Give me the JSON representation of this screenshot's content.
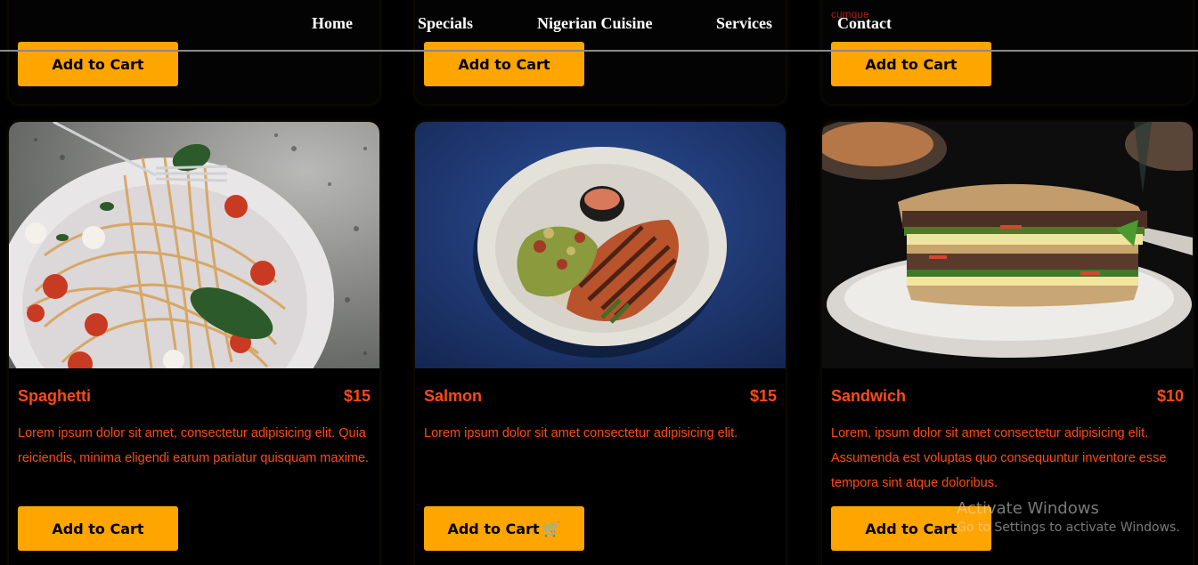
{
  "nav": {
    "links": [
      "Home",
      "Specials",
      "Nigerian Cuisine",
      "Services",
      "Contact"
    ],
    "stray_text": "cumque"
  },
  "top_row": {
    "buttons": [
      "Add to Cart",
      "Add to Cart",
      "Add to Cart"
    ]
  },
  "cards": [
    {
      "name": "Spaghetti",
      "price": "$15",
      "description": "Lorem ipsum dolor sit amet, consectetur adipisicing elit. Quia reiciendis, minima eligendi earum pariatur quisquam maxime.",
      "button": "Add to Cart",
      "image": "spaghetti-photo"
    },
    {
      "name": "Salmon",
      "price": "$15",
      "description": "Lorem ipsum dolor sit amet consectetur adipisicing elit.",
      "button": "Add to Cart",
      "button_icon": "🛒",
      "image": "salmon-photo"
    },
    {
      "name": "Sandwich",
      "price": "$10",
      "description": "Lorem, ipsum dolor sit amet consectetur adipisicing elit. Assumenda est voluptas quo consequuntur inventore esse tempora sint atque doloribus.",
      "button": "Add to Cart",
      "image": "sandwich-photo"
    }
  ],
  "watermark": {
    "title": "Activate Windows",
    "subtitle": "Go to Settings to activate Windows."
  },
  "colors": {
    "background": "#000000",
    "accent_text": "#ff4a12",
    "button": "#ffa500",
    "nav_text": "#ffffff"
  }
}
